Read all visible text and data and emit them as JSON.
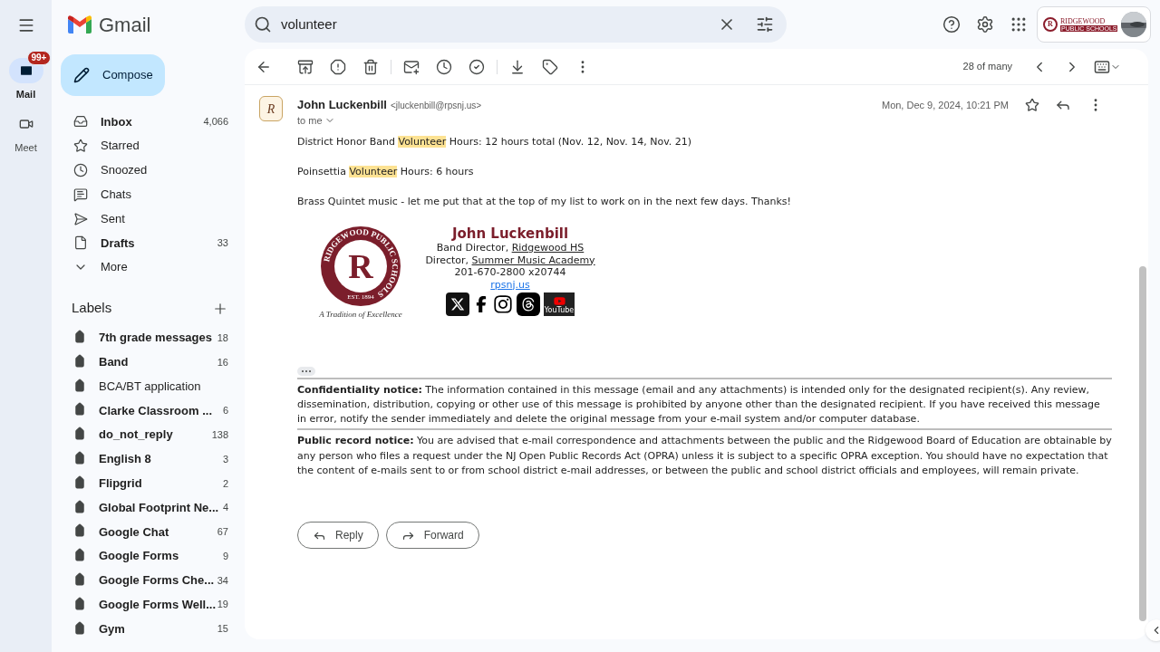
{
  "rail": {
    "items": [
      {
        "label": "Mail",
        "badge": "99+",
        "selected": true,
        "kind": "mail"
      },
      {
        "label": "Meet",
        "selected": false,
        "kind": "meet"
      }
    ]
  },
  "brand": "Gmail",
  "search": {
    "value": "volunteer"
  },
  "account": {
    "logo_letter": "R",
    "org_line1": "RIDGEWOOD",
    "org_line2": "PUBLIC SCHOOLS"
  },
  "compose": "Compose",
  "nav": [
    {
      "label": "Inbox",
      "count": "4,066",
      "unread": true,
      "kind": "inbox"
    },
    {
      "label": "Starred",
      "unread": false,
      "kind": "star"
    },
    {
      "label": "Snoozed",
      "unread": false,
      "kind": "clock"
    },
    {
      "label": "Chats",
      "unread": false,
      "kind": "chat"
    },
    {
      "label": "Sent",
      "unread": false,
      "kind": "send"
    },
    {
      "label": "Drafts",
      "count": "33",
      "unread": true,
      "kind": "draft"
    },
    {
      "label": "More",
      "unread": false,
      "kind": "more"
    }
  ],
  "labels": {
    "title": "Labels",
    "items": [
      {
        "label": "7th grade messages",
        "count": "18",
        "unread": true
      },
      {
        "label": "Band",
        "count": "16",
        "unread": true
      },
      {
        "label": "BCA/BT application",
        "unread": false
      },
      {
        "label": "Clarke Classroom ...",
        "count": "6",
        "unread": true
      },
      {
        "label": "do_not_reply",
        "count": "138",
        "unread": true
      },
      {
        "label": "English 8",
        "count": "3",
        "unread": true
      },
      {
        "label": "Flipgrid",
        "count": "2",
        "unread": true
      },
      {
        "label": "Global Footprint Ne...",
        "count": "4",
        "unread": true
      },
      {
        "label": "Google Chat",
        "count": "67",
        "unread": true
      },
      {
        "label": "Google Forms",
        "count": "9",
        "unread": true
      },
      {
        "label": "Google Forms Che...",
        "count": "34",
        "unread": true
      },
      {
        "label": "Google Forms Well...",
        "count": "19",
        "unread": true
      },
      {
        "label": "Gym",
        "count": "15",
        "unread": true
      }
    ]
  },
  "toolbar": {
    "position": "28 of many"
  },
  "message": {
    "avatar_letter": "R",
    "sender": "John Luckenbill",
    "email": "<jluckenbill@rpsnj.us>",
    "to": "to me",
    "date": "Mon, Dec 9, 2024, 10:21 PM",
    "starred": false,
    "paragraphs": [
      [
        {
          "text": "District Honor Band ",
          "highlight": false
        },
        {
          "text": "Volunteer",
          "highlight": true
        },
        {
          "text": " Hours: 12 hours total (Nov. 12, Nov. 14, Nov. 21)",
          "highlight": false
        }
      ],
      [
        {
          "text": "Poinsettia ",
          "highlight": false
        },
        {
          "text": "Volunteer",
          "highlight": true
        },
        {
          "text": " Hours: 6 hours",
          "highlight": false
        }
      ],
      [
        {
          "text": "Brass Quintet music - let me put that at the top of my list to work on in the next few days. Thanks!",
          "highlight": false
        }
      ]
    ],
    "signature": {
      "seal_ring": "RIDGEWOOD PUBLIC SCHOOLS",
      "seal_letter": "R",
      "seal_est": "EST. 1894",
      "tagline": "A Tradition of Excellence",
      "name": "John Luckenbill",
      "line1_prefix": "Band Director, ",
      "line1_link": "Ridgewood HS",
      "line2_prefix": "Director, ",
      "line2_link": "Summer Music Academy",
      "phone": "201-670-2800 x20744",
      "site": "rpsnj.us",
      "youtube_caption": "YouTube"
    },
    "notices": [
      "**Confidentiality notice:** The information contained in this message (email and any attachments) is intended only for the designated recipient(s). Any review, dissemination, distribution, copying or other use of this message is prohibited by anyone other than the designated recipient. If you have received this message in error, notify the sender immediately and delete the original message from your e-mail system and/or computer database.",
      "**Public record notice:** You are advised that e-mail correspondence and attachments between the public and the Ridgewood Board of Education are obtainable by any person who files a request under the NJ Open Public Records Act (OPRA) unless it is subject to a specific OPRA exception. You should have no expectation that the content of e-mails sent to or from school district e-mail addresses, or between the public and school district officials and employees, will remain private."
    ],
    "actions": [
      "Reply",
      "Forward"
    ]
  }
}
